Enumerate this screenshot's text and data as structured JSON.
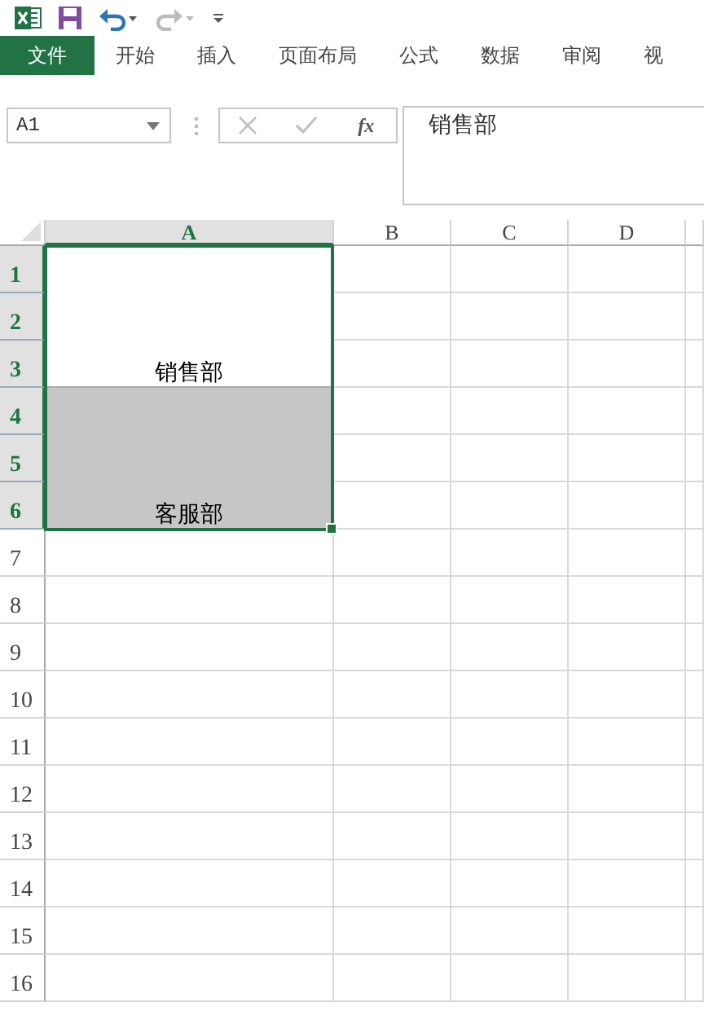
{
  "ribbon_tabs": [
    {
      "label": "文件",
      "selected": true
    },
    {
      "label": "开始",
      "selected": false
    },
    {
      "label": "插入",
      "selected": false
    },
    {
      "label": "页面布局",
      "selected": false
    },
    {
      "label": "公式",
      "selected": false
    },
    {
      "label": "数据",
      "selected": false
    },
    {
      "label": "审阅",
      "selected": false
    },
    {
      "label": "视",
      "selected": false
    }
  ],
  "name_box": {
    "value": "A1"
  },
  "formula_bar": {
    "function_label": "fx",
    "value": "销售部"
  },
  "sheet": {
    "columns": [
      {
        "label": "A",
        "selected": true
      },
      {
        "label": "B",
        "selected": false
      },
      {
        "label": "C",
        "selected": false
      },
      {
        "label": "D",
        "selected": false
      }
    ],
    "rows": [
      {
        "label": "1",
        "selected": true
      },
      {
        "label": "2",
        "selected": true
      },
      {
        "label": "3",
        "selected": true
      },
      {
        "label": "4",
        "selected": true
      },
      {
        "label": "5",
        "selected": true
      },
      {
        "label": "6",
        "selected": true
      },
      {
        "label": "7",
        "selected": false
      },
      {
        "label": "8",
        "selected": false
      },
      {
        "label": "9",
        "selected": false
      },
      {
        "label": "10",
        "selected": false
      },
      {
        "label": "11",
        "selected": false
      },
      {
        "label": "12",
        "selected": false
      },
      {
        "label": "13",
        "selected": false
      },
      {
        "label": "14",
        "selected": false
      },
      {
        "label": "15",
        "selected": false
      },
      {
        "label": "16",
        "selected": false
      }
    ],
    "merged_cells": [
      {
        "text": "销售部",
        "filled": false
      },
      {
        "text": "客服部",
        "filled": true
      }
    ]
  }
}
